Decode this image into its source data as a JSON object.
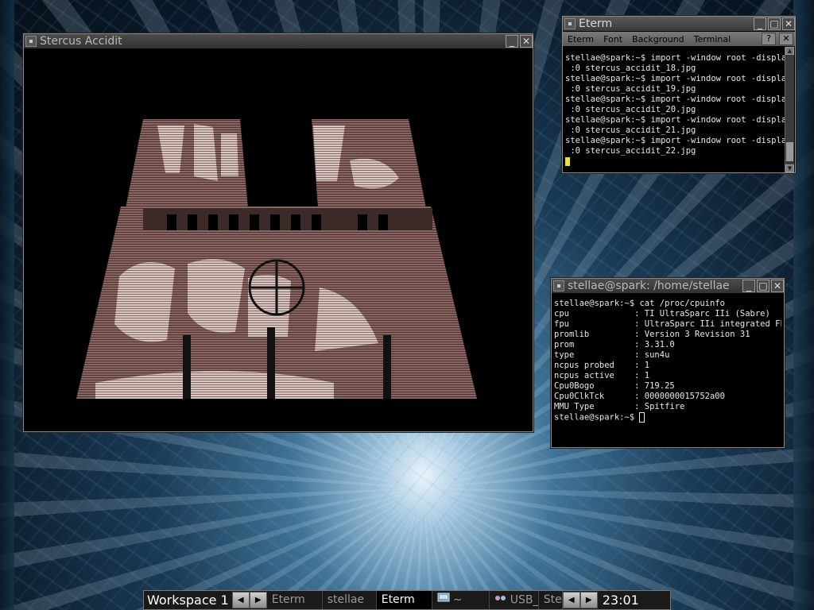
{
  "windows": {
    "stercus": {
      "title": "Stercus Accidit"
    },
    "eterm": {
      "title": "Eterm",
      "menu": [
        "Eterm",
        "Font",
        "Background",
        "Terminal"
      ],
      "help_label": "?",
      "close_label": "✕",
      "lines": [
        "stellae@spark:~$ import -window root -display",
        " :0 stercus_accidit_18.jpg",
        "stellae@spark:~$ import -window root -display",
        " :0 stercus_accidit_19.jpg",
        "stellae@spark:~$ import -window root -display",
        " :0 stercus_accidit_20.jpg",
        "stellae@spark:~$ import -window root -display",
        " :0 stercus_accidit_21.jpg",
        "stellae@spark:~$ import -window root -display",
        " :0 stercus_accidit_22.jpg"
      ]
    },
    "stellae": {
      "title": "stellae@spark: /home/stellae",
      "lines": [
        "stellae@spark:~$ cat /proc/cpuinfo",
        "cpu             : TI UltraSparc IIi (Sabre)",
        "fpu             : UltraSparc IIi integrated FPU",
        "promlib         : Version 3 Revision 31",
        "prom            : 3.31.0",
        "type            : sun4u",
        "ncpus probed    : 1",
        "ncpus active    : 1",
        "Cpu0Bogo        : 719.25",
        "Cpu0ClkTck      : 0000000015752a00",
        "MMU Type        : Spitfire"
      ],
      "prompt": "stellae@spark:~$ "
    }
  },
  "taskbar": {
    "workspace_label": "Workspace 1",
    "prev_label": "◀",
    "next_label": "▶",
    "tasks": [
      "Eterm",
      "stellae",
      "Eterm",
      "~",
      "USB_",
      "Ste"
    ],
    "clock": "23:01"
  },
  "colors": {
    "image_tint": "#7a5550",
    "cursor": "#f0e030"
  }
}
